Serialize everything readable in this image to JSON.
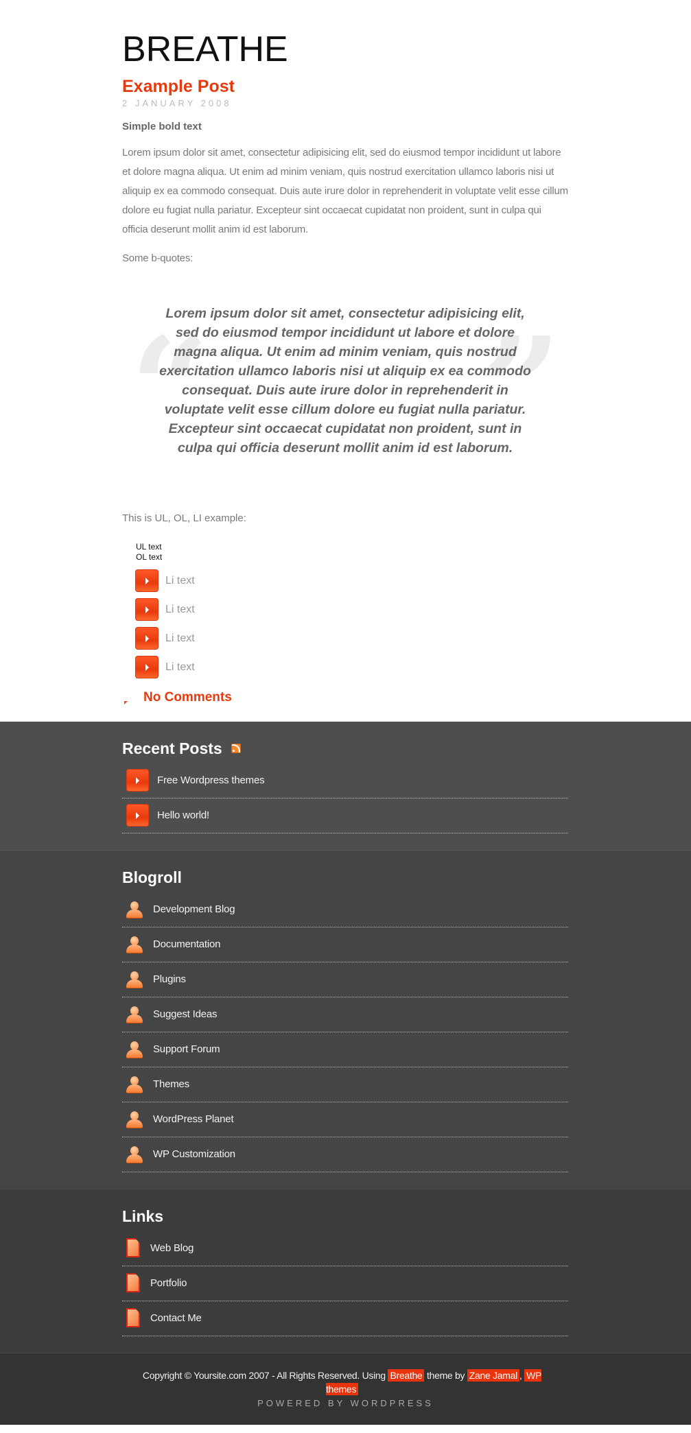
{
  "header": {
    "site_title": "BREATHE"
  },
  "post": {
    "title": "Example Post",
    "date": "2 JANUARY 2008",
    "bold_text": "Simple bold text",
    "paragraph": "Lorem ipsum dolor sit amet, consectetur adipisicing elit, sed do eiusmod tempor incididunt ut labore et dolore magna aliqua. Ut enim ad minim veniam, quis nostrud exercitation ullamco laboris nisi ut aliquip ex ea commodo consequat. Duis aute irure dolor in reprehenderit in voluptate velit esse cillum dolore eu fugiat nulla pariatur. Excepteur sint occaecat cupidatat non proident, sunt in culpa qui officia deserunt mollit anim id est laborum.",
    "bquotes_intro": "Some b-quotes:",
    "blockquote": {
      "open_mark": "“",
      "close_mark": "”",
      "text": "Lorem ipsum dolor sit amet, consectetur adipisicing elit, sed do eiusmod tempor incididunt ut labore et dolore magna aliqua. Ut enim ad minim veniam, quis nostrud exercitation ullamco laboris nisi ut aliquip ex ea commodo consequat. Duis aute irure dolor in reprehenderit in voluptate velit esse cillum dolore eu fugiat nulla pariatur. Excepteur sint occaecat cupidatat non proident, sunt in culpa qui officia deserunt mollit anim id est laborum."
    },
    "list_intro": "This is UL, OL, LI example:",
    "ul_text": "UL text",
    "ol_text": "OL text",
    "li_items": [
      "Li text",
      "Li text",
      "Li text",
      "Li text"
    ],
    "comments_link": "No Comments"
  },
  "recent_posts": {
    "heading": "Recent Posts",
    "items": [
      "Free Wordpress themes",
      "Hello world!"
    ]
  },
  "blogroll": {
    "heading": "Blogroll",
    "items": [
      "Development Blog",
      "Documentation",
      "Plugins",
      "Suggest Ideas",
      "Support Forum",
      "Themes",
      "WordPress Planet",
      "WP Customization"
    ]
  },
  "links": {
    "heading": "Links",
    "items": [
      "Web Blog",
      "Portfolio",
      "Contact Me"
    ]
  },
  "footer": {
    "copyright_prefix": "Copyright © Yoursite.com 2007 - All Rights Reserved. Using ",
    "theme_link": "Breathe",
    "theme_by": " theme by ",
    "author_link": "Zane Jamal",
    "separator": ", ",
    "wp_themes_link": "WP themes",
    "powered_by": "POWERED BY WORDPRESS"
  },
  "colors": {
    "accent": "#e43b10",
    "recent_bg": "#4e4e4e",
    "blogroll_bg": "#454545",
    "links_bg": "#3d3d3d",
    "footer_bg": "#333333"
  }
}
